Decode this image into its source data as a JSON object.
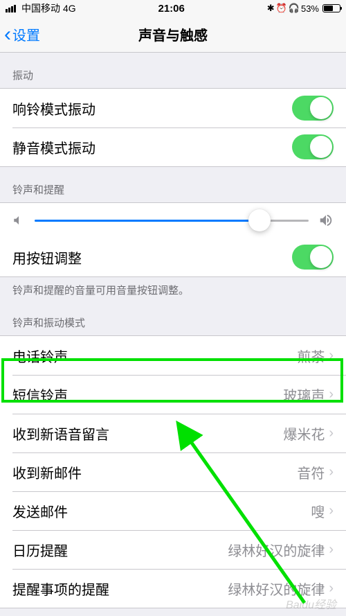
{
  "status": {
    "carrier": "中国移动",
    "network": "4G",
    "time": "21:06",
    "battery_pct": "53%"
  },
  "nav": {
    "back": "设置",
    "title": "声音与触感"
  },
  "sections": {
    "vibrate_header": "振动",
    "ring_header": "铃声和提醒",
    "ring_footer": "铃声和提醒的音量可用音量按钮调整。",
    "patterns_header": "铃声和振动模式"
  },
  "rows": {
    "vibrate_ring": "响铃模式振动",
    "vibrate_silent": "静音模式振动",
    "change_buttons": "用按钮调整",
    "ringtone": {
      "label": "电话铃声",
      "value": "煎茶"
    },
    "text_tone": {
      "label": "短信铃声",
      "value": "玻璃声"
    },
    "voicemail": {
      "label": "收到新语音留言",
      "value": "爆米花"
    },
    "new_mail": {
      "label": "收到新邮件",
      "value": "音符"
    },
    "sent_mail": {
      "label": "发送邮件",
      "value": "嗖"
    },
    "calendar": {
      "label": "日历提醒",
      "value": "绿林好汉的旋律"
    },
    "reminder": {
      "label": "提醒事项的提醒",
      "value": "绿林好汉的旋律"
    }
  },
  "watermark": "Baidu经验"
}
